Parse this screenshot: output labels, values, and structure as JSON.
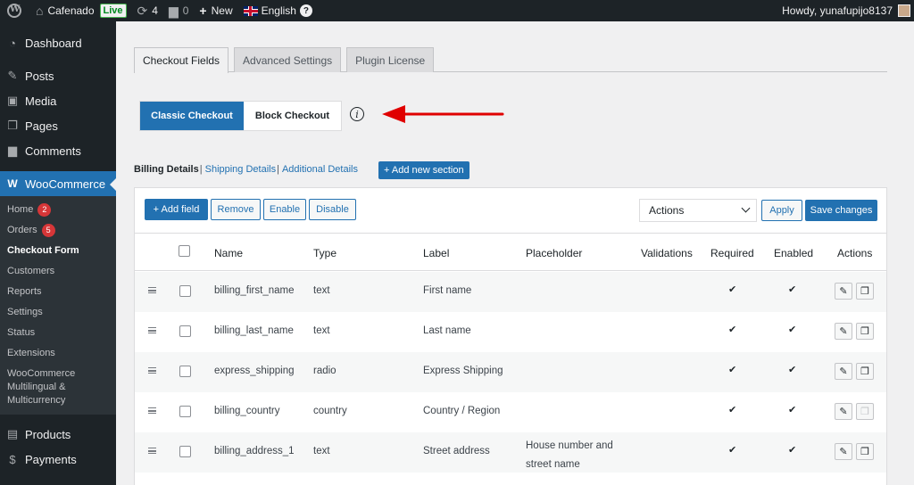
{
  "adminbar": {
    "site_name": "Cafenado",
    "live_badge": "Live",
    "updates_count": "4",
    "comments_count": "0",
    "new_label": "New",
    "language": "English",
    "howdy": "Howdy, yunafupijo8137"
  },
  "sidebar": {
    "dashboard": "Dashboard",
    "posts": "Posts",
    "media": "Media",
    "pages": "Pages",
    "comments": "Comments",
    "woocommerce": "WooCommerce",
    "submenu": {
      "home": "Home",
      "home_count": "2",
      "orders": "Orders",
      "orders_count": "5",
      "checkout_form": "Checkout Form",
      "customers": "Customers",
      "reports": "Reports",
      "settings": "Settings",
      "status": "Status",
      "extensions": "Extensions",
      "multilingual_1": "WooCommerce",
      "multilingual_2": "Multilingual &",
      "multilingual_3": "Multicurrency"
    },
    "products": "Products",
    "payments": "Payments"
  },
  "tabs": {
    "checkout_fields": "Checkout Fields",
    "advanced_settings": "Advanced Settings",
    "plugin_license": "Plugin License"
  },
  "mode_toggle": {
    "classic": "Classic Checkout",
    "block": "Block Checkout",
    "info": "i"
  },
  "sections": {
    "billing": "Billing Details",
    "shipping": "Shipping Details",
    "additional": "Additional Details",
    "separator": "|",
    "add_new": "+ Add new section"
  },
  "toolbar": {
    "add_field": "+ Add field",
    "remove": "Remove",
    "enable": "Enable",
    "disable": "Disable",
    "actions_select": "Actions",
    "apply": "Apply",
    "save_changes": "Save changes"
  },
  "table": {
    "headers": {
      "name": "Name",
      "type": "Type",
      "label": "Label",
      "placeholder": "Placeholder",
      "validations": "Validations",
      "required": "Required",
      "enabled": "Enabled",
      "actions": "Actions"
    },
    "check_glyph": "✔",
    "rows": [
      {
        "name": "billing_first_name",
        "type": "text",
        "label": "First name",
        "placeholder": "",
        "required": true,
        "enabled": true
      },
      {
        "name": "billing_last_name",
        "type": "text",
        "label": "Last name",
        "placeholder": "",
        "required": true,
        "enabled": true
      },
      {
        "name": "express_shipping",
        "type": "radio",
        "label": "Express Shipping",
        "placeholder": "",
        "required": true,
        "enabled": true
      },
      {
        "name": "billing_country",
        "type": "country",
        "label": "Country / Region",
        "placeholder": "",
        "required": true,
        "enabled": true
      },
      {
        "name": "billing_address_1",
        "type": "text",
        "label": "Street address",
        "placeholder": "House number and street name",
        "required": true,
        "enabled": true
      }
    ]
  },
  "colors": {
    "accent": "#2271b1",
    "admin_dark": "#1d2327",
    "badge_red": "#d63638",
    "arrow_red": "#e00000"
  }
}
